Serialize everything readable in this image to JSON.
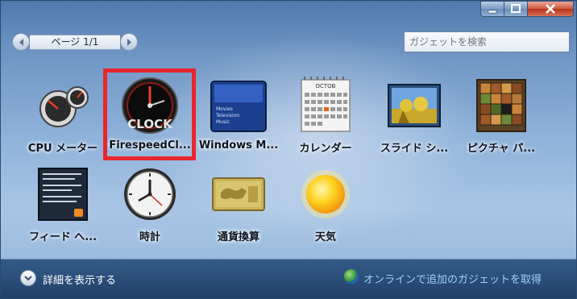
{
  "window": {
    "caption_buttons": {
      "minimize_icon": "minimize-icon",
      "maximize_icon": "maximize-icon",
      "close_icon": "close-icon"
    }
  },
  "pager": {
    "label": "ページ 1/1",
    "prev_icon": "chevron-left-icon",
    "next_icon": "chevron-right-icon"
  },
  "search": {
    "placeholder": "ガジェットを検索"
  },
  "gadgets": [
    {
      "label": "CPU メーター",
      "icon": "cpu-meter-icon"
    },
    {
      "label": "FirespeedCl...",
      "icon": "firespeed-clock-icon",
      "selected": true,
      "thumb_text": "CLOCK"
    },
    {
      "label": "Windows M...",
      "icon": "windows-media-center-icon",
      "thumb_lines": [
        "Movies",
        "Television",
        "Music"
      ]
    },
    {
      "label": "カレンダー",
      "icon": "calendar-icon",
      "thumb_text": "OCTOB"
    },
    {
      "label": "スライド シ...",
      "icon": "slide-show-icon"
    },
    {
      "label": "ピクチャ パ...",
      "icon": "picture-puzzle-icon"
    },
    {
      "label": "フィード へ...",
      "icon": "feed-headlines-icon"
    },
    {
      "label": "時計",
      "icon": "clock-icon"
    },
    {
      "label": "通貨換算",
      "icon": "currency-icon"
    },
    {
      "label": "天気",
      "icon": "weather-icon"
    }
  ],
  "footer": {
    "details_label": "詳細を表示する",
    "details_icon": "chevron-down-icon",
    "online_label": "オンラインで追加のガジェットを取得",
    "online_icon": "globe-icon"
  },
  "colors": {
    "selection": "#e8262d",
    "link": "#9fd0ff"
  }
}
